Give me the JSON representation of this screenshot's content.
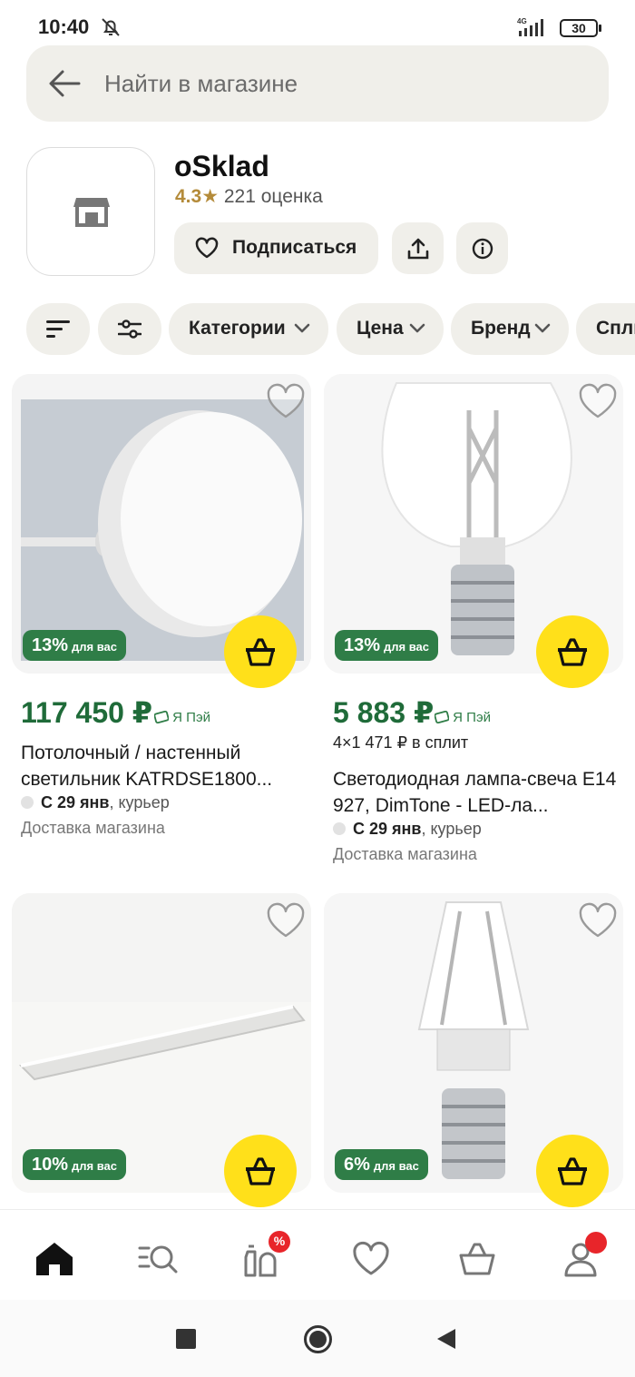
{
  "status_bar": {
    "time": "10:40",
    "network": "4G",
    "battery": "30"
  },
  "search": {
    "placeholder": "Найти в магазине"
  },
  "store": {
    "name": "oSklad",
    "rating": "4.3",
    "star": "★",
    "rating_count": "221 оценка",
    "subscribe_label": "Подписаться"
  },
  "filters": {
    "chips": [
      "Категории",
      "Цена",
      "Бренд",
      "Спли"
    ]
  },
  "products": [
    {
      "discount": "13%",
      "discount_suffix": "для вас",
      "price": "117 450 ₽",
      "pay_label": "Я Пэй",
      "split": "",
      "title": "Потолочный / настенный светильник KATRDSE1800...",
      "delivery_date": "С 29 янв",
      "delivery_method": ", курьер",
      "shipper": "Доставка магазина"
    },
    {
      "discount": "13%",
      "discount_suffix": "для вас",
      "price": "5 883 ₽",
      "pay_label": "Я Пэй",
      "split": "4×1 471 ₽ в сплит",
      "title": "Светодиодная лампа-свеча E14 927, DimTone - LED-ла...",
      "delivery_date": "С 29 янв",
      "delivery_method": ", курьер",
      "shipper": "Доставка магазина"
    },
    {
      "discount": "10%",
      "discount_suffix": "для вас"
    },
    {
      "discount": "6%",
      "discount_suffix": "для вас"
    }
  ],
  "bottom_nav": {
    "promo_badge": "%"
  },
  "colors": {
    "accent_yellow": "#ffe01a",
    "discount_green": "#2f7d47",
    "price_green": "#1f6b39",
    "chip_bg": "#f0efea"
  }
}
